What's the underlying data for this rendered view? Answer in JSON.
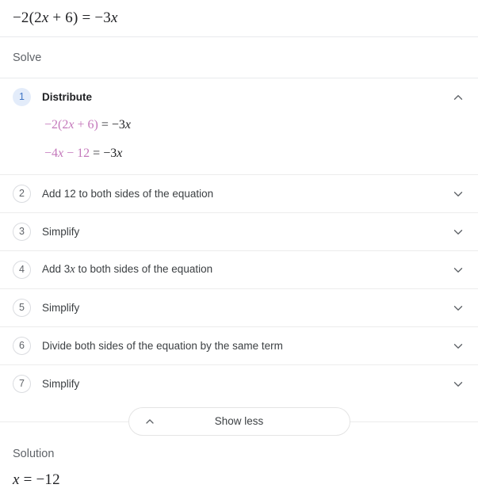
{
  "query": {
    "equation_parts": [
      {
        "text": "−2(2",
        "italic": false
      },
      {
        "text": "x",
        "italic": true
      },
      {
        "text": " + 6) = −3",
        "italic": false
      },
      {
        "text": "x",
        "italic": true
      }
    ],
    "equation_plain": "−2(2x + 6) = −3x"
  },
  "solve": {
    "heading": "Solve"
  },
  "steps": [
    {
      "number": "1",
      "label": "Distribute",
      "expanded": true,
      "chevron": "chevron-up-icon",
      "lines": [
        {
          "highlight": "−2(2x + 6)",
          "highlight_parts": [
            {
              "text": "−2(2",
              "italic": false
            },
            {
              "text": "x",
              "italic": true
            },
            {
              "text": " + 6)",
              "italic": false
            }
          ],
          "plain": " = −3x",
          "plain_parts": [
            {
              "text": " = −3",
              "italic": false
            },
            {
              "text": "x",
              "italic": true
            }
          ]
        },
        {
          "highlight": "−4x − 12",
          "highlight_parts": [
            {
              "text": "−4",
              "italic": false
            },
            {
              "text": "x",
              "italic": true
            },
            {
              "text": " − 12",
              "italic": false
            }
          ],
          "plain": " = −3x",
          "plain_parts": [
            {
              "text": " = −3",
              "italic": false
            },
            {
              "text": "x",
              "italic": true
            }
          ]
        }
      ]
    },
    {
      "number": "2",
      "label": "Add 12 to both sides of the equation",
      "label_parts": [
        {
          "text": "Add 12 to both sides of the equation",
          "italic": false
        }
      ],
      "expanded": false,
      "chevron": "chevron-down-icon"
    },
    {
      "number": "3",
      "label": "Simplify",
      "label_parts": [
        {
          "text": "Simplify",
          "italic": false
        }
      ],
      "expanded": false,
      "chevron": "chevron-down-icon"
    },
    {
      "number": "4",
      "label": "Add 3x to both sides of the equation",
      "label_parts": [
        {
          "text": "Add 3",
          "italic": false
        },
        {
          "text": "x",
          "italic": true
        },
        {
          "text": " to both sides of the equation",
          "italic": false
        }
      ],
      "expanded": false,
      "chevron": "chevron-down-icon"
    },
    {
      "number": "5",
      "label": "Simplify",
      "label_parts": [
        {
          "text": "Simplify",
          "italic": false
        }
      ],
      "expanded": false,
      "chevron": "chevron-down-icon"
    },
    {
      "number": "6",
      "label": "Divide both sides of the equation by the same term",
      "label_parts": [
        {
          "text": "Divide both sides of the equation by the same term",
          "italic": false
        }
      ],
      "expanded": false,
      "chevron": "chevron-down-icon"
    },
    {
      "number": "7",
      "label": "Simplify",
      "label_parts": [
        {
          "text": "Simplify",
          "italic": false
        }
      ],
      "expanded": false,
      "chevron": "chevron-down-icon"
    }
  ],
  "show_less": {
    "label": "Show less",
    "chevron": "chevron-up-icon"
  },
  "solution": {
    "label": "Solution",
    "equation_plain": "x = −12",
    "equation_parts": [
      {
        "text": "x",
        "italic": true
      },
      {
        "text": " = −12",
        "italic": false
      }
    ]
  },
  "colors": {
    "highlight": "#c478bb",
    "active_badge_bg": "#e3ecfa",
    "active_badge_text": "#3f74c4",
    "text": "#3c4043",
    "muted": "#5f6368",
    "divider": "#ececec"
  }
}
